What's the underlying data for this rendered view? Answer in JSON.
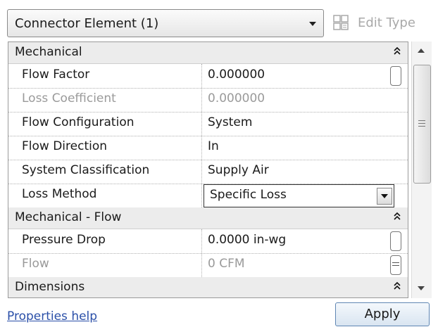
{
  "header": {
    "type_selector": "Connector Element (1)",
    "edit_type_label": "Edit Type"
  },
  "groups": [
    {
      "label": "Mechanical"
    },
    {
      "label": "Mechanical - Flow"
    },
    {
      "label": "Dimensions"
    }
  ],
  "properties": {
    "mechanical": [
      {
        "name": "Flow Factor",
        "value": "0.000000"
      },
      {
        "name": "Loss Coefficient",
        "value": "0.000000"
      },
      {
        "name": "Flow Configuration",
        "value": "System"
      },
      {
        "name": "Flow Direction",
        "value": "In"
      },
      {
        "name": "System Classification",
        "value": "Supply Air"
      },
      {
        "name": "Loss Method",
        "value": "Specific Loss"
      }
    ],
    "mechanical_flow": [
      {
        "name": "Pressure Drop",
        "value": "0.0000 in-wg"
      },
      {
        "name": "Flow",
        "value": "0 CFM"
      }
    ]
  },
  "footer": {
    "help_link": "Properties help",
    "apply_label": "Apply"
  },
  "icons": [
    "dropdown-arrow-icon",
    "edit-type-icon",
    "collapse-chevron-icon",
    "scroll-up-icon",
    "scroll-down-icon",
    "scroll-grip-icon"
  ]
}
